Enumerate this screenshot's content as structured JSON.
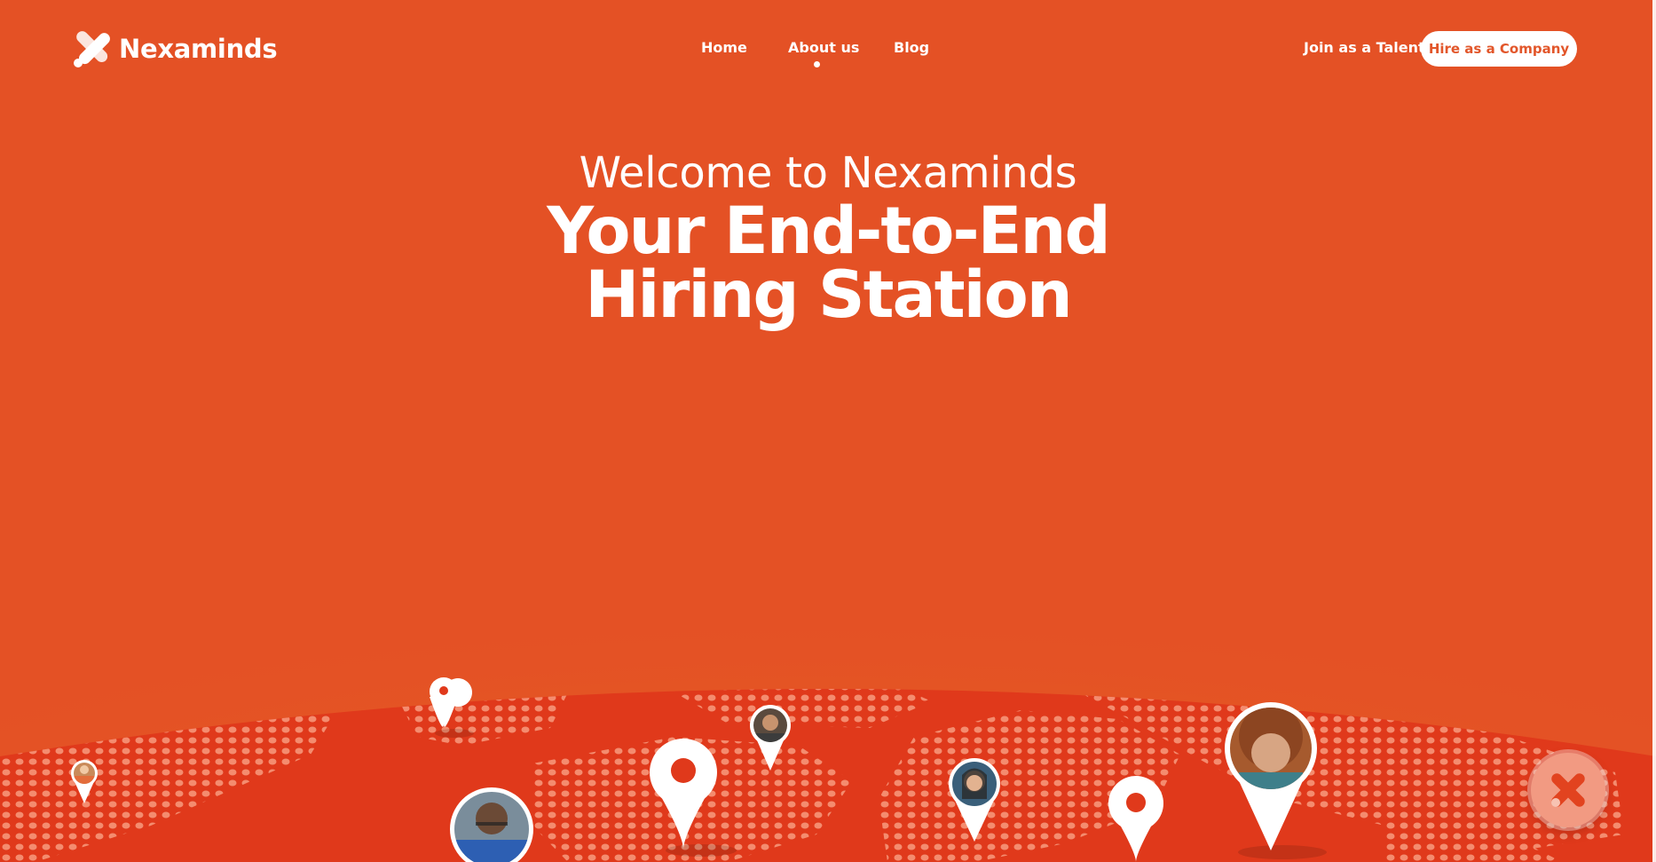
{
  "brand": {
    "name": "Nexaminds",
    "logo_icon": "x-logo-icon"
  },
  "nav": {
    "items": [
      {
        "label": "Home",
        "active": false
      },
      {
        "label": "About us",
        "active": true
      },
      {
        "label": "Blog",
        "active": false
      }
    ],
    "join_label": "Join as a Talent",
    "hire_label": "Hire as a Company"
  },
  "hero": {
    "welcome": "Welcome to Nexaminds",
    "headline_line1": "Your End-to-End",
    "headline_line2": "Hiring Station"
  },
  "colors": {
    "background": "#e45125",
    "globe": "#e0391b",
    "dots": "#f48c6f",
    "accent_text": "#e2562a"
  },
  "map": {
    "pins": [
      "location-pin-icon",
      "avatar-pin-icon"
    ]
  },
  "chat_button": {
    "icon": "x-logo-icon"
  }
}
